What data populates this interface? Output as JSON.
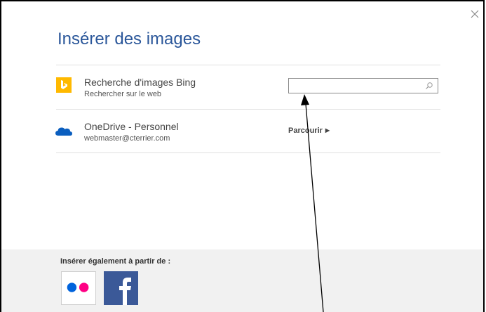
{
  "dialog": {
    "title": "Insérer des images"
  },
  "sources": [
    {
      "title": "Recherche d'images Bing",
      "subtitle": "Rechercher sur le web",
      "icon": "bing-icon",
      "search": {
        "placeholder": "",
        "value": ""
      }
    },
    {
      "title": "OneDrive - Personnel",
      "subtitle": "webmaster@cterrier.com",
      "icon": "onedrive-icon",
      "browse_label": "Parcourir"
    }
  ],
  "footer": {
    "label": "Insérer également à partir de :",
    "services": [
      "flickr-icon",
      "facebook-icon"
    ]
  },
  "colors": {
    "title": "#2b579a",
    "bing": "#ffb900",
    "onedrive": "#0a5ebf",
    "facebook": "#3b5998",
    "flickr_blue": "#0063dc",
    "flickr_pink": "#ff0084",
    "footer_bg": "#f1f1f1"
  }
}
